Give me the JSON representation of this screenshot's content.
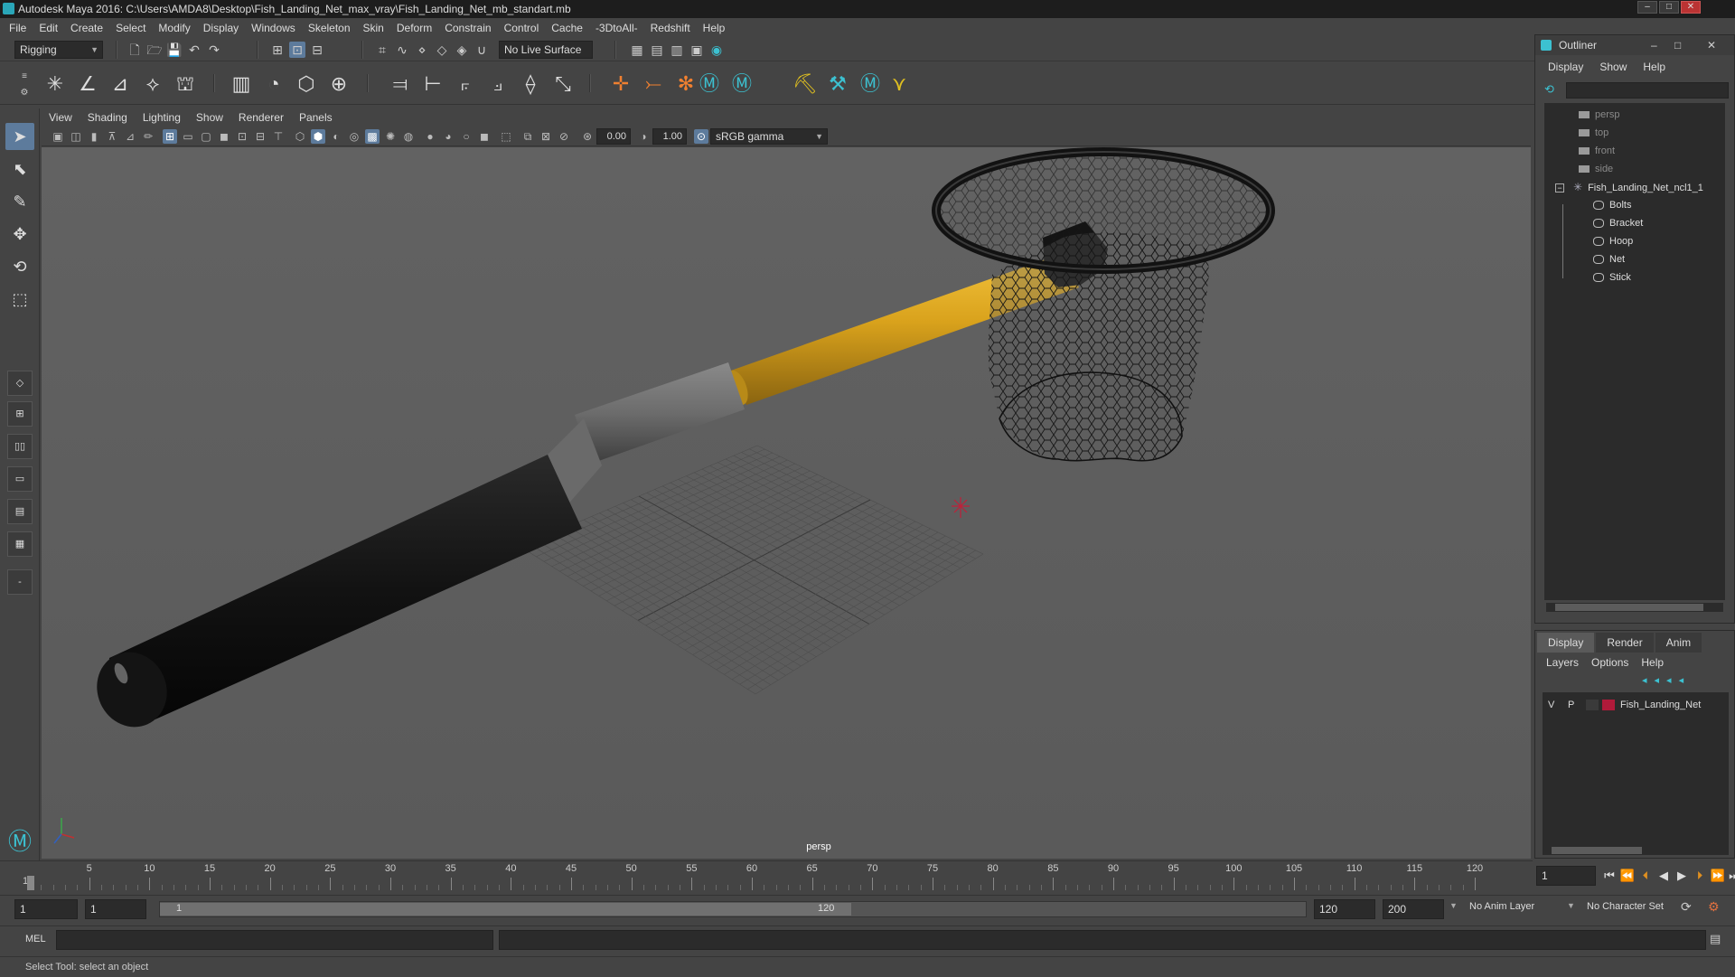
{
  "window": {
    "title": "Autodesk Maya 2016: C:\\Users\\AMDA8\\Desktop\\Fish_Landing_Net_max_vray\\Fish_Landing_Net_mb_standart.mb",
    "controls": [
      "–",
      "□",
      "✕"
    ]
  },
  "menubar": [
    "File",
    "Edit",
    "Create",
    "Select",
    "Modify",
    "Display",
    "Windows",
    "Skeleton",
    "Skin",
    "Deform",
    "Constrain",
    "Control",
    "Cache",
    "-3DtoAll-",
    "Redshift",
    "Help"
  ],
  "statusline": {
    "menuset": "Rigging",
    "live_surface": "No Live Surface"
  },
  "viewport": {
    "menu": [
      "View",
      "Shading",
      "Lighting",
      "Show",
      "Renderer",
      "Panels"
    ],
    "exposure": "0.00",
    "gamma": "1.00",
    "colorspace": "sRGB gamma",
    "camera_label": "persp"
  },
  "timeline": {
    "ticks": [
      5,
      10,
      15,
      20,
      25,
      30,
      35,
      40,
      45,
      50,
      55,
      60,
      65,
      70,
      75,
      80,
      85,
      90,
      95,
      100,
      105,
      110,
      115,
      120
    ],
    "first": "1",
    "current_frame": "1"
  },
  "range": {
    "start": "1",
    "playback_start": "1",
    "slider_start": "1",
    "slider_end": "120",
    "playback_end": "120",
    "end": "200",
    "anim_layer": "No Anim Layer",
    "character_set": "No Character Set"
  },
  "cmdline": {
    "label": "MEL"
  },
  "helpline": "Select Tool: select an object",
  "outliner": {
    "title": "Outliner",
    "menu": [
      "Display",
      "Show",
      "Help"
    ],
    "cameras": [
      "persp",
      "top",
      "front",
      "side"
    ],
    "root": "Fish_Landing_Net_ncl1_1",
    "children": [
      "Bolts",
      "Bracket",
      "Hoop",
      "Net",
      "Stick"
    ]
  },
  "layers": {
    "tabs": [
      "Display",
      "Render",
      "Anim"
    ],
    "menu": [
      "Layers",
      "Options",
      "Help"
    ],
    "rows": [
      {
        "v": "V",
        "p": "P",
        "name": "Fish_Landing_Net",
        "color": "#b01a3a"
      }
    ]
  },
  "colors": {
    "accent": "#5d7b9c",
    "handle_yellow": "#d9a21c"
  }
}
